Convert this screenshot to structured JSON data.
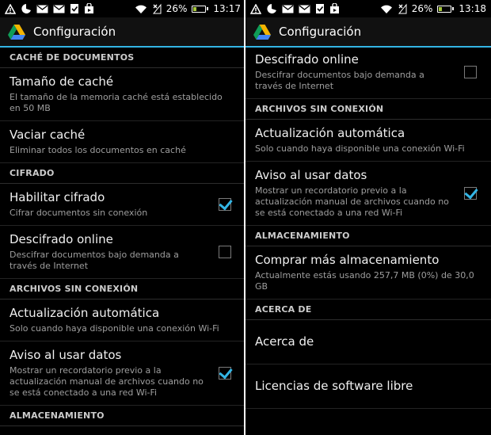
{
  "status": {
    "battery": "26%",
    "time_left": "13:17",
    "time_right": "13:18"
  },
  "app": {
    "title": "Configuración"
  },
  "left": {
    "sections": [
      {
        "header": "CACHÉ DE DOCUMENTOS",
        "items": [
          {
            "title": "Tamaño de caché",
            "summary": "El tamaño de la memoria caché está establecido en 50 MB",
            "check": null
          },
          {
            "title": "Vaciar caché",
            "summary": "Eliminar todos los documentos en caché",
            "check": null
          }
        ]
      },
      {
        "header": "CIFRADO",
        "items": [
          {
            "title": "Habilitar cifrado",
            "summary": "Cifrar documentos sin conexión",
            "check": true
          },
          {
            "title": "Descifrado online",
            "summary": "Descifrar documentos bajo demanda a través de Internet",
            "check": false
          }
        ]
      },
      {
        "header": "ARCHIVOS SIN CONEXIÓN",
        "items": [
          {
            "title": "Actualización automática",
            "summary": "Solo cuando haya disponible una conexión Wi-Fi",
            "check": null
          },
          {
            "title": "Aviso al usar datos",
            "summary": "Mostrar un recordatorio previo a la actualización manual de archivos cuando no se está conectado a una red Wi-Fi",
            "check": true
          }
        ]
      },
      {
        "header": "ALMACENAMIENTO",
        "items": []
      }
    ]
  },
  "right": {
    "sections": [
      {
        "header": "",
        "items": [
          {
            "title": "Descifrado online",
            "summary": "Descifrar documentos bajo demanda a través de Internet",
            "check": false
          }
        ]
      },
      {
        "header": "ARCHIVOS SIN CONEXIÓN",
        "items": [
          {
            "title": "Actualización automática",
            "summary": "Solo cuando haya disponible una conexión Wi-Fi",
            "check": null
          },
          {
            "title": "Aviso al usar datos",
            "summary": "Mostrar un recordatorio previo a la actualización manual de archivos cuando no se está conectado a una red Wi-Fi",
            "check": true
          }
        ]
      },
      {
        "header": "ALMACENAMIENTO",
        "items": [
          {
            "title": "Comprar más almacenamiento",
            "summary": "Actualmente estás usando 257,7 MB (0%) de 30,0 GB",
            "check": null
          }
        ]
      },
      {
        "header": "ACERCA DE",
        "items": [
          {
            "title": "Acerca de",
            "summary": "",
            "check": null,
            "tall": true
          },
          {
            "title": "Licencias de software libre",
            "summary": "",
            "check": null,
            "tall": true
          }
        ]
      }
    ]
  },
  "colors": {
    "accent": "#33b5e5",
    "background": "#000000",
    "battery_fill": "#a4c639",
    "drive_green": "#0f9d58",
    "drive_yellow": "#f4b400",
    "drive_blue": "#4285f4"
  },
  "icons": {
    "status_left": [
      "alert-icon",
      "pacman-icon",
      "gmail-icon",
      "gmail-icon",
      "download-done-icon",
      "shop-bag-icon"
    ],
    "status_right": [
      "wifi-icon",
      "no-signal-icon",
      "battery-icon"
    ],
    "app": "google-drive-icon"
  }
}
